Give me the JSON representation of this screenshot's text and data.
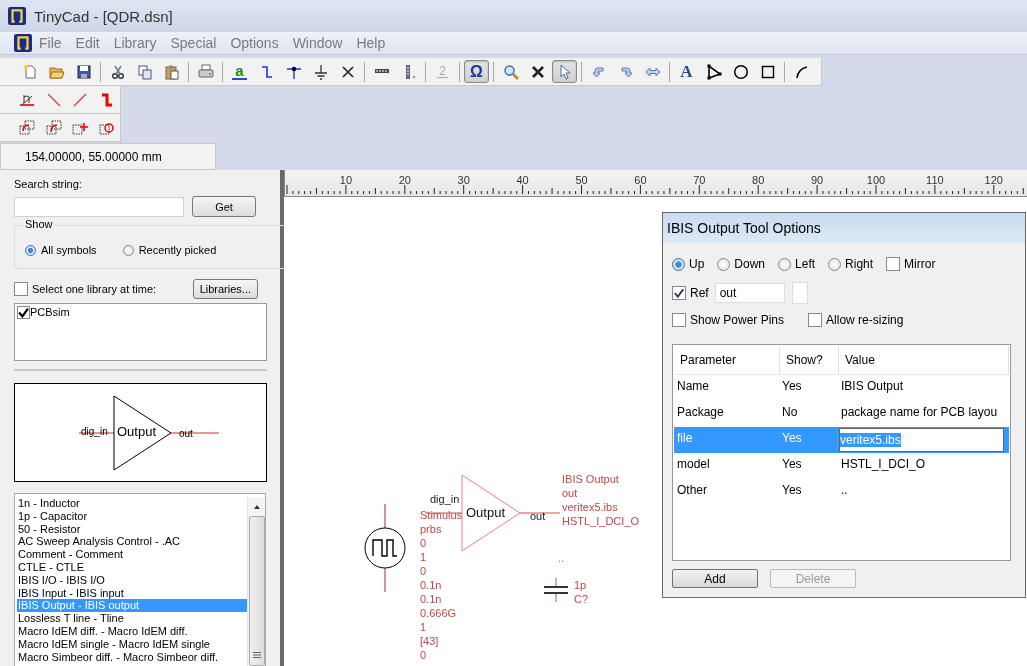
{
  "window": {
    "title": "TinyCad - [QDR.dsn]"
  },
  "menu": [
    "File",
    "Edit",
    "Library",
    "Special",
    "Options",
    "Window",
    "Help"
  ],
  "toolbar_main": [
    [
      {
        "kind": "new",
        "pressed": false
      },
      {
        "kind": "open",
        "pressed": false
      },
      {
        "kind": "save",
        "pressed": false
      }
    ],
    [
      {
        "kind": "cut",
        "pressed": false
      },
      {
        "kind": "copy",
        "pressed": false
      },
      {
        "kind": "paste",
        "pressed": false
      }
    ],
    [
      {
        "kind": "print",
        "pressed": false
      }
    ],
    [
      {
        "kind": "label",
        "glyph": "a",
        "pressed": false
      },
      {
        "kind": "wire",
        "pressed": false
      },
      {
        "kind": "junction",
        "pressed": false
      },
      {
        "kind": "ground",
        "pressed": false
      },
      {
        "kind": "noconnect",
        "pressed": false
      }
    ],
    [
      {
        "kind": "ruler-h",
        "pressed": false
      },
      {
        "kind": "ruler-v",
        "pressed": false
      }
    ],
    [
      {
        "kind": "pin-number",
        "glyph": "2",
        "pressed": false
      }
    ],
    [
      {
        "kind": "symbol",
        "glyph": "Ω",
        "pressed": true
      }
    ],
    [
      {
        "kind": "zoom",
        "pressed": false
      },
      {
        "kind": "delete",
        "pressed": false
      },
      {
        "kind": "select",
        "pressed": true
      }
    ],
    [
      {
        "kind": "rotate-left",
        "pressed": false
      },
      {
        "kind": "rotate-right",
        "pressed": false
      },
      {
        "kind": "mirror",
        "pressed": false
      }
    ],
    [
      {
        "kind": "text",
        "glyph": "A",
        "pressed": false
      },
      {
        "kind": "polygon",
        "pressed": false
      },
      {
        "kind": "circle",
        "pressed": false
      },
      {
        "kind": "square",
        "pressed": false
      }
    ],
    [
      {
        "kind": "arc",
        "pressed": false
      }
    ]
  ],
  "toolbar_draw": [
    {
      "kind": "power",
      "pressed": false
    },
    {
      "kind": "line-down",
      "pressed": false
    },
    {
      "kind": "line-up",
      "pressed": false
    },
    {
      "kind": "step",
      "pressed": false
    }
  ],
  "toolbar_block": [
    {
      "kind": "block-move",
      "pressed": false
    },
    {
      "kind": "block-copy",
      "pressed": false
    },
    {
      "kind": "block-add",
      "pressed": false
    },
    {
      "kind": "block-rotate",
      "pressed": false
    }
  ],
  "coordinates": "154.00000,   55.00000 mm",
  "library_panel": {
    "search_label": "Search string:",
    "get_button": "Get",
    "show_group": {
      "label": "Show",
      "options": [
        {
          "label": "All symbols",
          "selected": true
        },
        {
          "label": "Recently picked",
          "selected": false
        }
      ]
    },
    "one_library": {
      "label": "Select one library at time:",
      "checked": false
    },
    "libraries_button": "Libraries...",
    "libraries": [
      {
        "name": "PCBsim",
        "checked": true
      }
    ],
    "preview": {
      "input": "dig_in",
      "body": "Output",
      "output": "out"
    },
    "symbols": [
      {
        "label": "1n - Inductor",
        "selected": false
      },
      {
        "label": "1p - Capacitor",
        "selected": false
      },
      {
        "label": "50 - Resistor",
        "selected": false
      },
      {
        "label": "AC Sweep Analysis Control - .AC",
        "selected": false
      },
      {
        "label": "Comment - Comment",
        "selected": false
      },
      {
        "label": "CTLE - CTLE",
        "selected": false
      },
      {
        "label": "IBIS I/O - IBIS I/O",
        "selected": false
      },
      {
        "label": "IBIS Input - IBIS input",
        "selected": false
      },
      {
        "label": "IBIS Output - IBIS output",
        "selected": true
      },
      {
        "label": "Lossless T line - Tline",
        "selected": false
      },
      {
        "label": "Macro IdEM diff. - Macro IdEM diff.",
        "selected": false
      },
      {
        "label": "Macro IdEM single - Macro IdEM single",
        "selected": false
      },
      {
        "label": "Macro Simbeor diff. - Macro Simbeor diff.",
        "selected": false
      }
    ]
  },
  "ruler": {
    "labels": [
      "10",
      "20",
      "30",
      "40",
      "50",
      "60",
      "70",
      "80",
      "90",
      "100",
      "110",
      "120"
    ]
  },
  "schematic": {
    "stimulus": [
      "Stimulus",
      "prbs",
      "0",
      "1",
      "0",
      "0.1n",
      "0.1n",
      "0.666G",
      "1",
      "[43]",
      "0"
    ],
    "buffer": {
      "input": "dig_in",
      "body": "Output",
      "output": "out",
      "attributes": [
        "IBIS Output",
        "out",
        "veritex5.ibs",
        "HSTL_I_DCI_O"
      ]
    },
    "marker": "..",
    "capacitor": {
      "value": "1p",
      "ref": "C?"
    }
  },
  "dialog": {
    "title": "IBIS Output Tool Options",
    "orientations": [
      {
        "label": "Up",
        "selected": true
      },
      {
        "label": "Down",
        "selected": false
      },
      {
        "label": "Left",
        "selected": false
      },
      {
        "label": "Right",
        "selected": false
      }
    ],
    "mirror": {
      "label": "Mirror",
      "checked": false
    },
    "ref": {
      "label": "Ref",
      "checked": true,
      "value": "out"
    },
    "show_power_pins": {
      "label": "Show Power Pins",
      "checked": false
    },
    "allow_resizing": {
      "label": "Allow re-sizing",
      "checked": false
    },
    "table": {
      "columns": [
        "Parameter",
        "Show?",
        "Value"
      ],
      "rows": [
        {
          "cells": [
            "Name",
            "Yes",
            "IBIS Output"
          ],
          "selected": false
        },
        {
          "cells": [
            "Package",
            "No",
            "package name for PCB layou"
          ],
          "selected": false
        },
        {
          "cells": [
            "file",
            "Yes",
            "veritex5.ibs"
          ],
          "selected": true
        },
        {
          "cells": [
            "model",
            "Yes",
            "HSTL_I_DCI_O"
          ],
          "selected": false
        },
        {
          "cells": [
            "Other",
            "Yes",
            ".."
          ],
          "selected": false
        }
      ]
    },
    "buttons": [
      {
        "label": "Add",
        "disabled": false
      },
      {
        "label": "Delete",
        "disabled": true
      }
    ]
  }
}
